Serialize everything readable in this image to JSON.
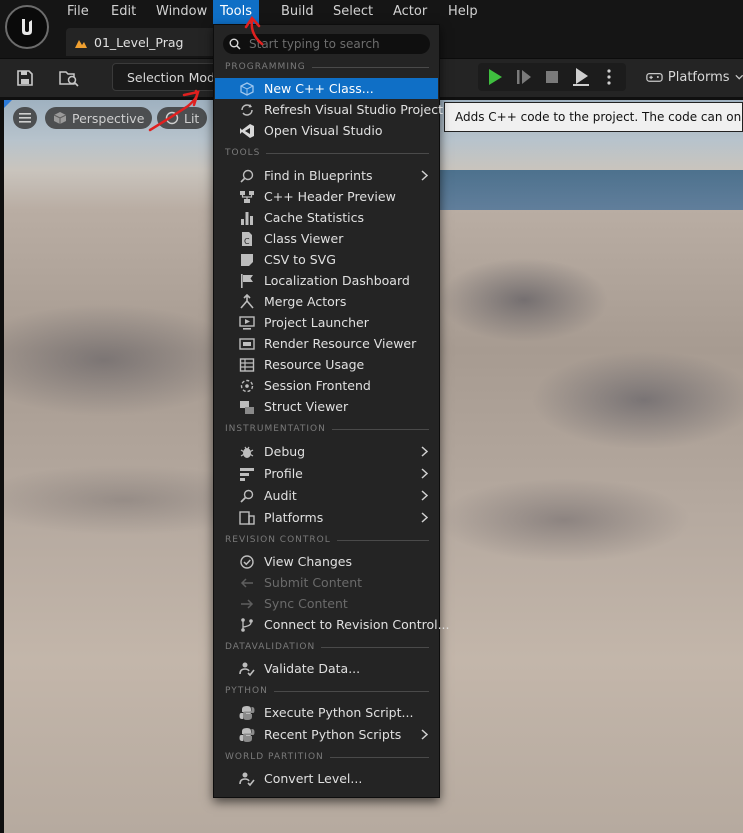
{
  "menubar": {
    "items": [
      "File",
      "Edit",
      "Window",
      "Tools",
      "Build",
      "Select",
      "Actor",
      "Help"
    ],
    "active": "Tools"
  },
  "tab": {
    "label": "01_Level_Prag"
  },
  "toolbar": {
    "selection_mode_label": "Selection Mode",
    "platforms_label": "Platforms"
  },
  "viewport": {
    "perspective_label": "Perspective",
    "lit_label": "Lit"
  },
  "tooltip": {
    "text": "Adds C++ code to the project. The code can only be compiled"
  },
  "tools_menu": {
    "search_placeholder": "Start typing to search",
    "sections": {
      "programming": "PROGRAMMING",
      "tools": "TOOLS",
      "instrumentation": "INSTRUMENTATION",
      "revision_control": "REVISION CONTROL",
      "datavalidation": "DATAVALIDATION",
      "python": "PYTHON",
      "world_partition": "WORLD PARTITION"
    },
    "programming": [
      "New C++ Class...",
      "Refresh Visual Studio Project",
      "Open Visual Studio"
    ],
    "tools": [
      "Find in Blueprints",
      "C++ Header Preview",
      "Cache Statistics",
      "Class Viewer",
      "CSV to SVG",
      "Localization Dashboard",
      "Merge Actors",
      "Project Launcher",
      "Render Resource Viewer",
      "Resource Usage",
      "Session Frontend",
      "Struct Viewer"
    ],
    "instrumentation": [
      "Debug",
      "Profile",
      "Audit",
      "Platforms"
    ],
    "revision_control": [
      "View Changes",
      "Submit Content",
      "Sync Content",
      "Connect to Revision Control..."
    ],
    "datavalidation": [
      "Validate Data..."
    ],
    "python": [
      "Execute Python Script...",
      "Recent Python Scripts"
    ],
    "world_partition": [
      "Convert Level..."
    ]
  },
  "colors": {
    "accent": "#0f6fc6",
    "menu_bg": "#242424",
    "annotation": "#e0201f",
    "play_green": "#3fbf3f"
  }
}
